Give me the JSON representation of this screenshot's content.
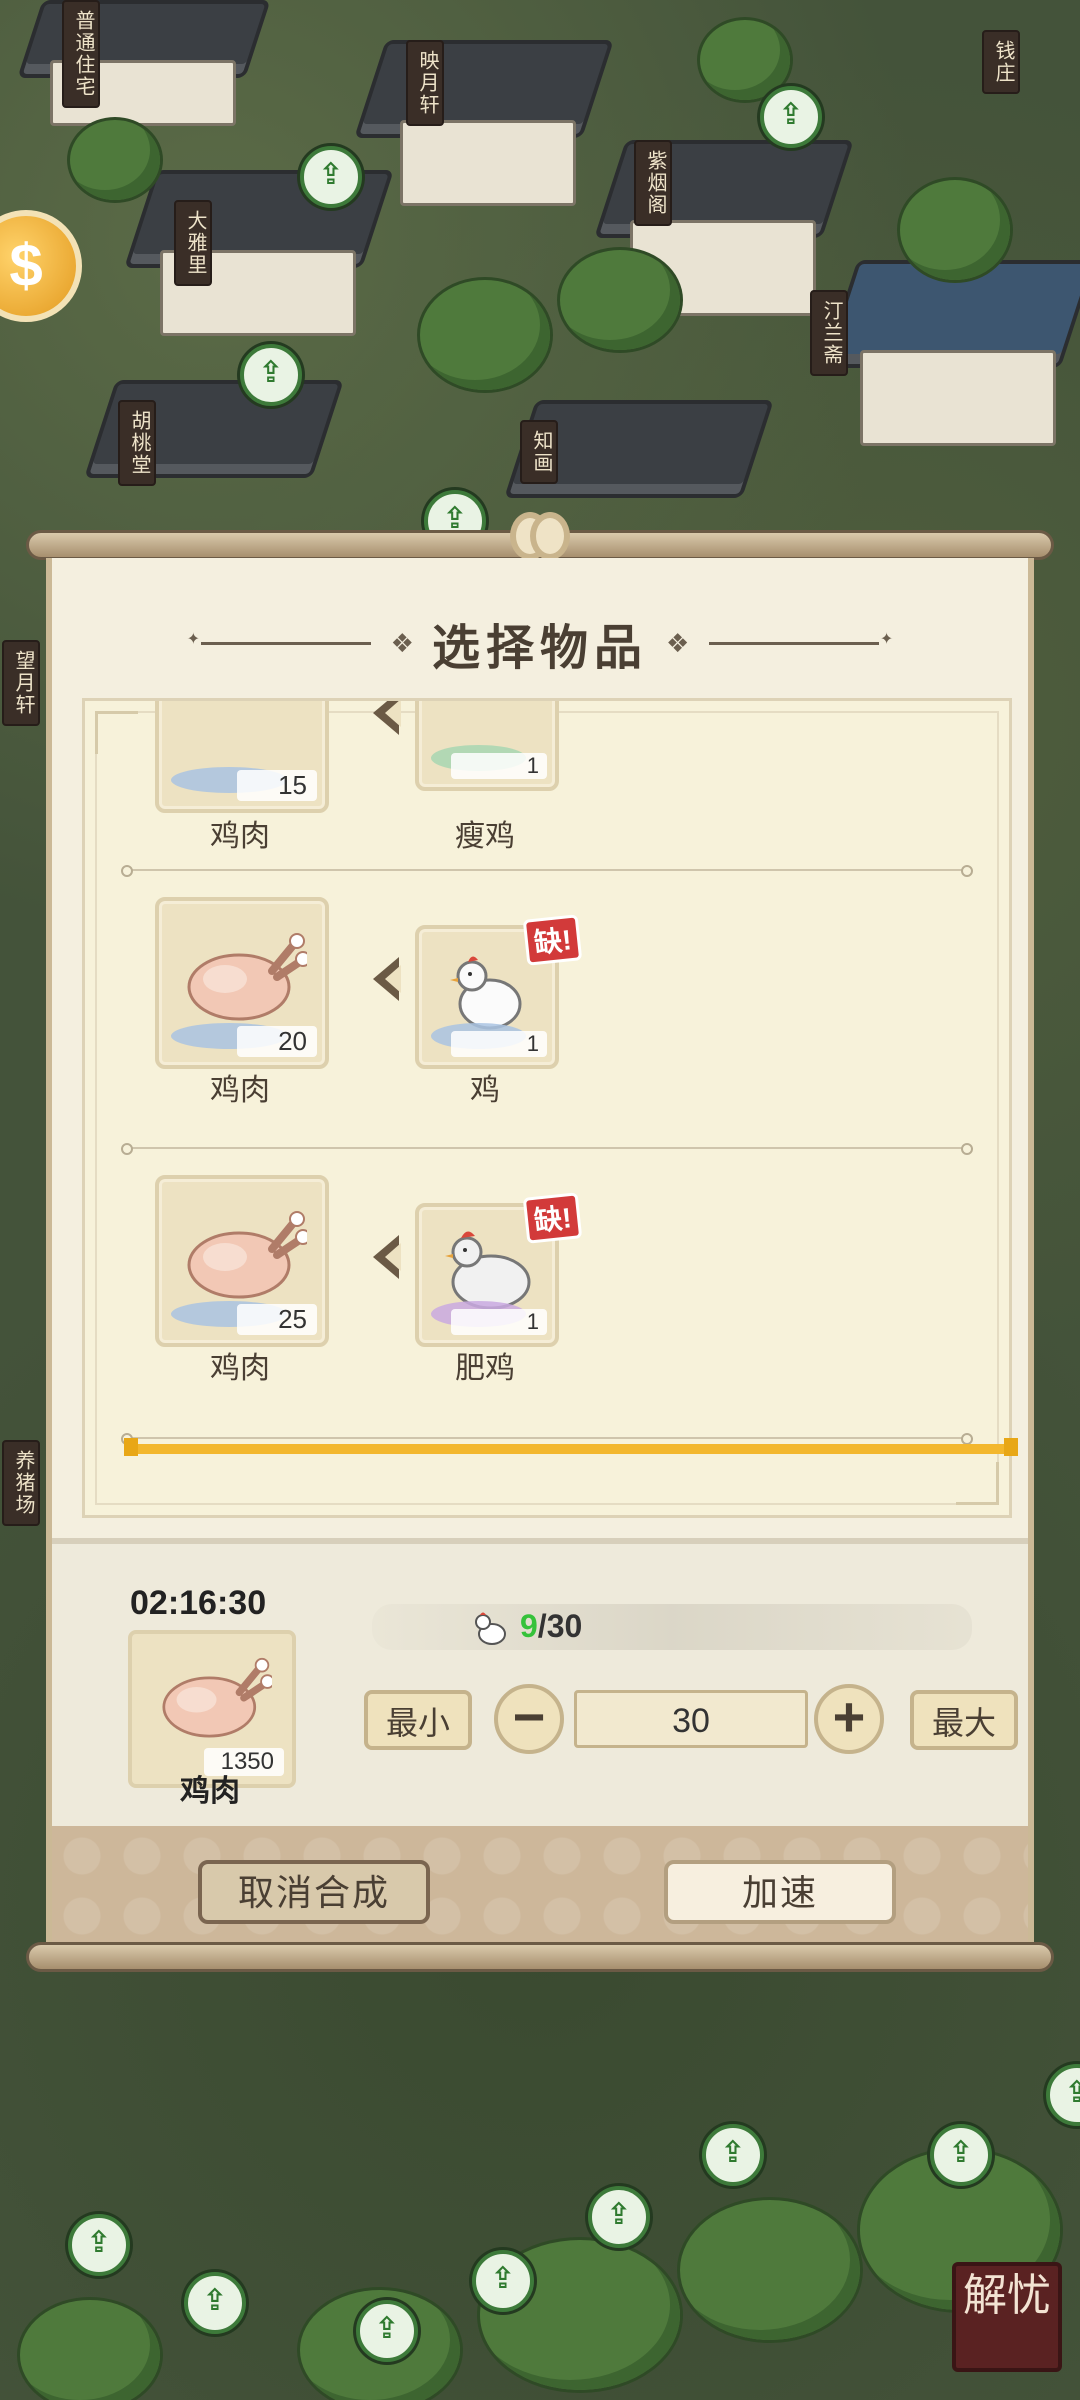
{
  "map": {
    "signs": [
      "普通住宅",
      "映月轩",
      "钱庄",
      "大雅里",
      "紫烟阁",
      "汀兰斋",
      "胡桃堂",
      "知画",
      "望月轩",
      "养猪场"
    ],
    "pin_icon": "green-arrow-up-pin",
    "corner_button_label": "解忧"
  },
  "dialog": {
    "title": "选择物品",
    "recipes": [
      {
        "output_name": "鸡肉",
        "output_qty": "15",
        "input_name": "瘦鸡",
        "input_qty": "1",
        "lacking": false
      },
      {
        "output_name": "鸡肉",
        "output_qty": "20",
        "input_name": "鸡",
        "input_qty": "1",
        "lacking": true
      },
      {
        "output_name": "鸡肉",
        "output_qty": "25",
        "input_name": "肥鸡",
        "input_qty": "1",
        "lacking": true
      }
    ],
    "lack_label": "缺!",
    "colors": {
      "accent_gold": "#f3b72d",
      "lack_red": "#d23a3a",
      "count_green": "#35c23a"
    }
  },
  "production": {
    "timer": "02:16:30",
    "product_name": "鸡肉",
    "product_qty": "1350",
    "count_current": "9",
    "count_total": "/30",
    "min_label": "最小",
    "max_label": "最大",
    "quantity_value": "30",
    "minus_label": "−",
    "plus_label": "+"
  },
  "footer": {
    "cancel_label": "取消合成",
    "speed_label": "加速"
  }
}
